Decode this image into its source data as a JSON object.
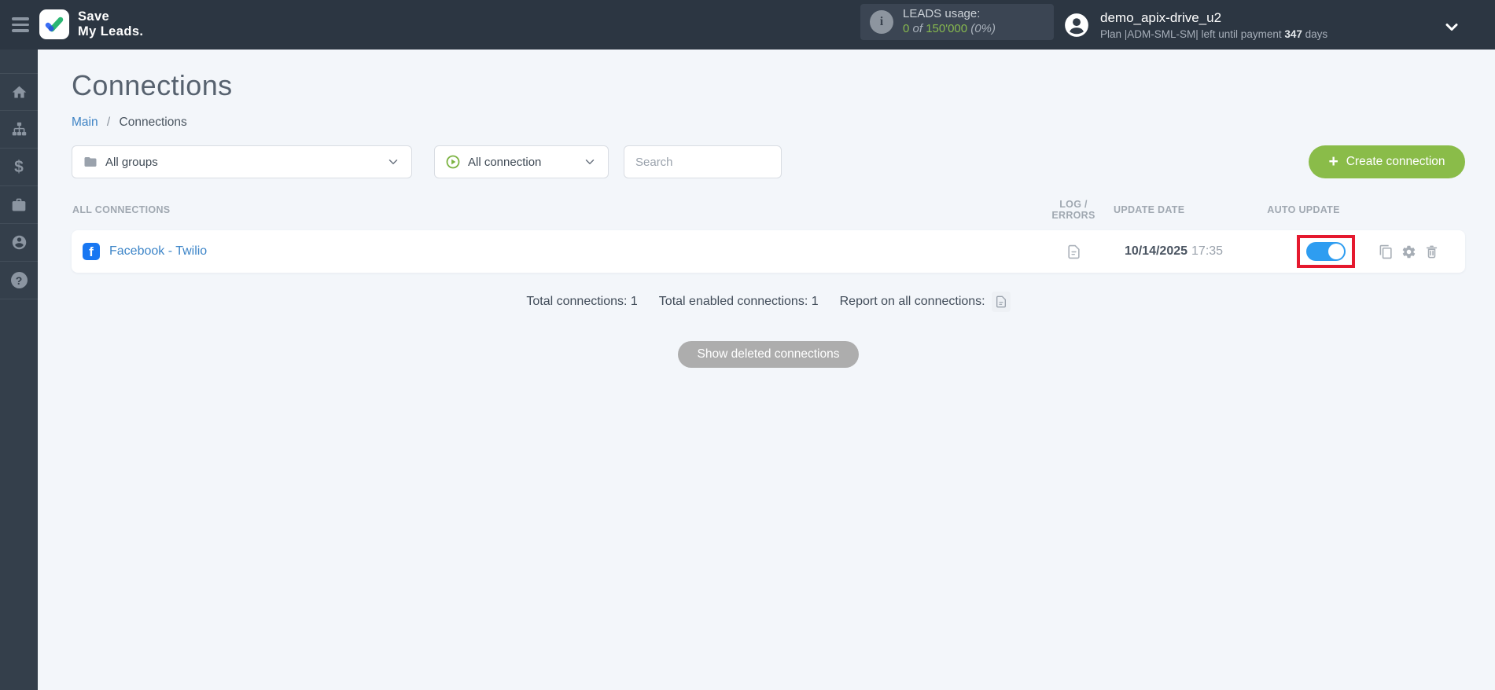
{
  "colors": {
    "brand_green": "#8abc49",
    "green_text": "#87b94e",
    "toggle_blue": "#2e9df1",
    "link_blue": "#3d85c8",
    "facebook_blue": "#1877f2",
    "highlight_red": "#e5192e",
    "header_dark": "#2c3642"
  },
  "header": {
    "logo_line1": "Save",
    "logo_line2": "My Leads.",
    "leads": {
      "label": "LEADS usage:",
      "used": "0",
      "of_word": "of",
      "total": "150'000",
      "percent": "(0%)"
    },
    "user": {
      "name": "demo_apix-drive_u2",
      "plan_prefix": "Plan |ADM-SML-SM| left until payment",
      "days_value": "347",
      "days_suffix": "days"
    },
    "info_glyph": "i"
  },
  "sidebar": {
    "items": [
      {
        "icon": "home-icon"
      },
      {
        "icon": "sitemap-icon"
      },
      {
        "icon": "dollar-icon",
        "glyph": "$"
      },
      {
        "icon": "briefcase-icon"
      },
      {
        "icon": "user-icon"
      },
      {
        "icon": "help-icon",
        "glyph": "?"
      }
    ]
  },
  "page": {
    "title": "Connections",
    "breadcrumb": {
      "main": "Main",
      "separator": "/",
      "current": "Connections"
    }
  },
  "filters": {
    "groups_value": "All groups",
    "connection_value": "All connection",
    "search_placeholder": "Search",
    "create_label": "Create connection",
    "plus_glyph": "+"
  },
  "table": {
    "headers": {
      "connections": "ALL CONNECTIONS",
      "log": "LOG / ERRORS",
      "update": "UPDATE DATE",
      "auto": "AUTO UPDATE"
    },
    "rows": [
      {
        "name": "Facebook - Twilio",
        "source_glyph": "f",
        "date": "10/14/2025",
        "time": "17:35",
        "auto_update": "on",
        "actions": [
          "copy-icon",
          "gear-icon",
          "trash-icon"
        ]
      }
    ]
  },
  "summary": {
    "total": "Total connections: 1",
    "enabled": "Total enabled connections: 1",
    "report_label": "Report on all connections:"
  },
  "footer": {
    "show_deleted": "Show deleted connections"
  }
}
